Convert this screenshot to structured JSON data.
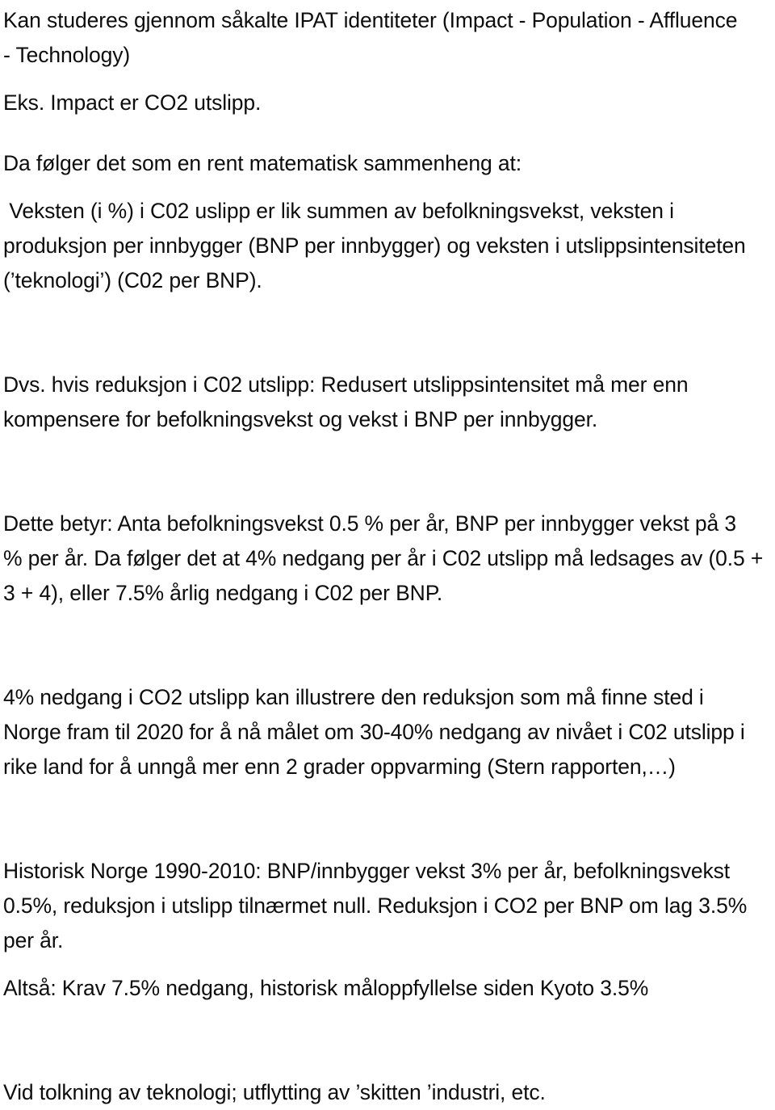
{
  "document": {
    "language": "no",
    "text_color": "#0d0d0d",
    "background_color": "#ffffff"
  },
  "blocks": [
    {
      "id": "ipat-intro",
      "lines": [
        "Kan studeres gjennom såkalte IPAT identiteter (Impact - Population - Affluence",
        "- Technology)"
      ]
    },
    {
      "id": "impact-example",
      "lines": [
        "Eks. Impact er CO2 utslipp."
      ]
    },
    {
      "id": "math-relation",
      "lines": [
        "Da følger det som en rent matematisk sammenheng at:"
      ]
    },
    {
      "id": "growth-identity",
      "lines": [
        " Veksten (i %) i C02 uslipp er lik summen av befolkningsvekst, veksten i",
        "produksjon per innbygger (BNP per innbygger) og veksten i utslippsintensiteten",
        "(’teknologi’) (C02 per BNP)."
      ]
    },
    {
      "id": "reduction-implication",
      "lines": [
        "Dvs. hvis reduksjon i C02 utslipp: Redusert utslippsintensitet må mer enn",
        "kompensere for befolkningsvekst og vekst i BNP per innbygger."
      ]
    },
    {
      "id": "numeric-example",
      "lines": [
        "Dette betyr: Anta befolkningsvekst 0.5 % per år, BNP per innbygger vekst på 3",
        "% per år. Da følger det at 4% nedgang per år i C02 utslipp må ledsages av (0.5 +",
        "3 + 4), eller 7.5% årlig nedgang i C02 per BNP."
      ]
    },
    {
      "id": "norway-2020-target",
      "lines": [
        "4% nedgang i CO2 utslipp kan illustrere den reduksjon som må finne sted i",
        "Norge fram til 2020 for å nå målet om 30-40% nedgang av nivået i C02 utslipp i",
        "rike land for å unngå mer enn 2 grader oppvarming (Stern rapporten,…)"
      ]
    },
    {
      "id": "historic-norway",
      "lines": [
        "Historisk Norge 1990-2010: BNP/innbygger vekst 3% per år, befolkningsvekst",
        "0.5%, reduksjon i utslipp tilnærmet null. Reduksjon i CO2 per BNP om lag 3.5%",
        "per år."
      ]
    },
    {
      "id": "conclusion",
      "lines": [
        "Altså: Krav 7.5% nedgang, historisk måloppfyllelse siden Kyoto 3.5%"
      ]
    },
    {
      "id": "technology-caveat",
      "lines": [
        "Vid tolkning av teknologi; utflytting av ’skitten ’industri, etc."
      ]
    }
  ]
}
